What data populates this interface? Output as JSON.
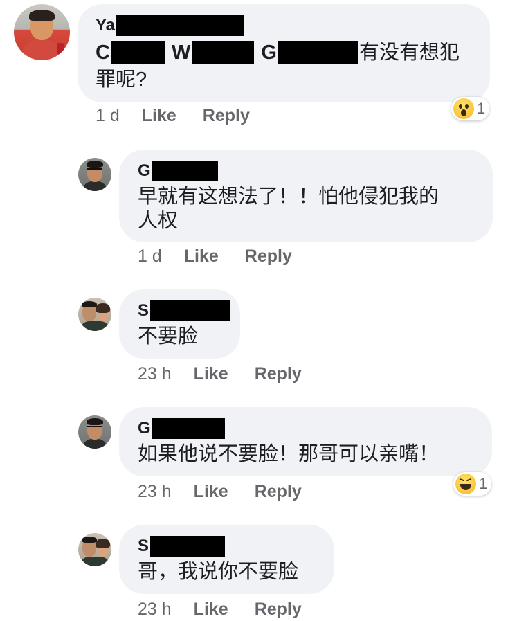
{
  "comments": [
    {
      "author_initial": "Ya",
      "text_parts": {
        "n1": "C",
        "n2": "W",
        "n3": "G",
        "t1": "有没有想犯",
        "t2": "罪呢?"
      },
      "time": "1 d",
      "like": "Like",
      "reply": "Reply",
      "reaction": {
        "icon": "wow-reaction-icon",
        "count": "1"
      }
    },
    {
      "author_initial": "G",
      "line1": "早就有这想法了！！怕他侵犯我的",
      "line2": "人权",
      "time": "1 d",
      "like": "Like",
      "reply": "Reply"
    },
    {
      "author_initial": "S",
      "line1": "不要脸",
      "time": "23 h",
      "like": "Like",
      "reply": "Reply"
    },
    {
      "author_initial": "G",
      "line1": "如果他说不要脸！那哥可以亲嘴！",
      "time": "23 h",
      "like": "Like",
      "reply": "Reply",
      "reaction": {
        "icon": "haha-reaction-icon",
        "count": "1"
      }
    },
    {
      "author_initial": "S",
      "line1": "哥，我说你不要脸",
      "time": "23 h",
      "like": "Like",
      "reply": "Reply"
    }
  ]
}
